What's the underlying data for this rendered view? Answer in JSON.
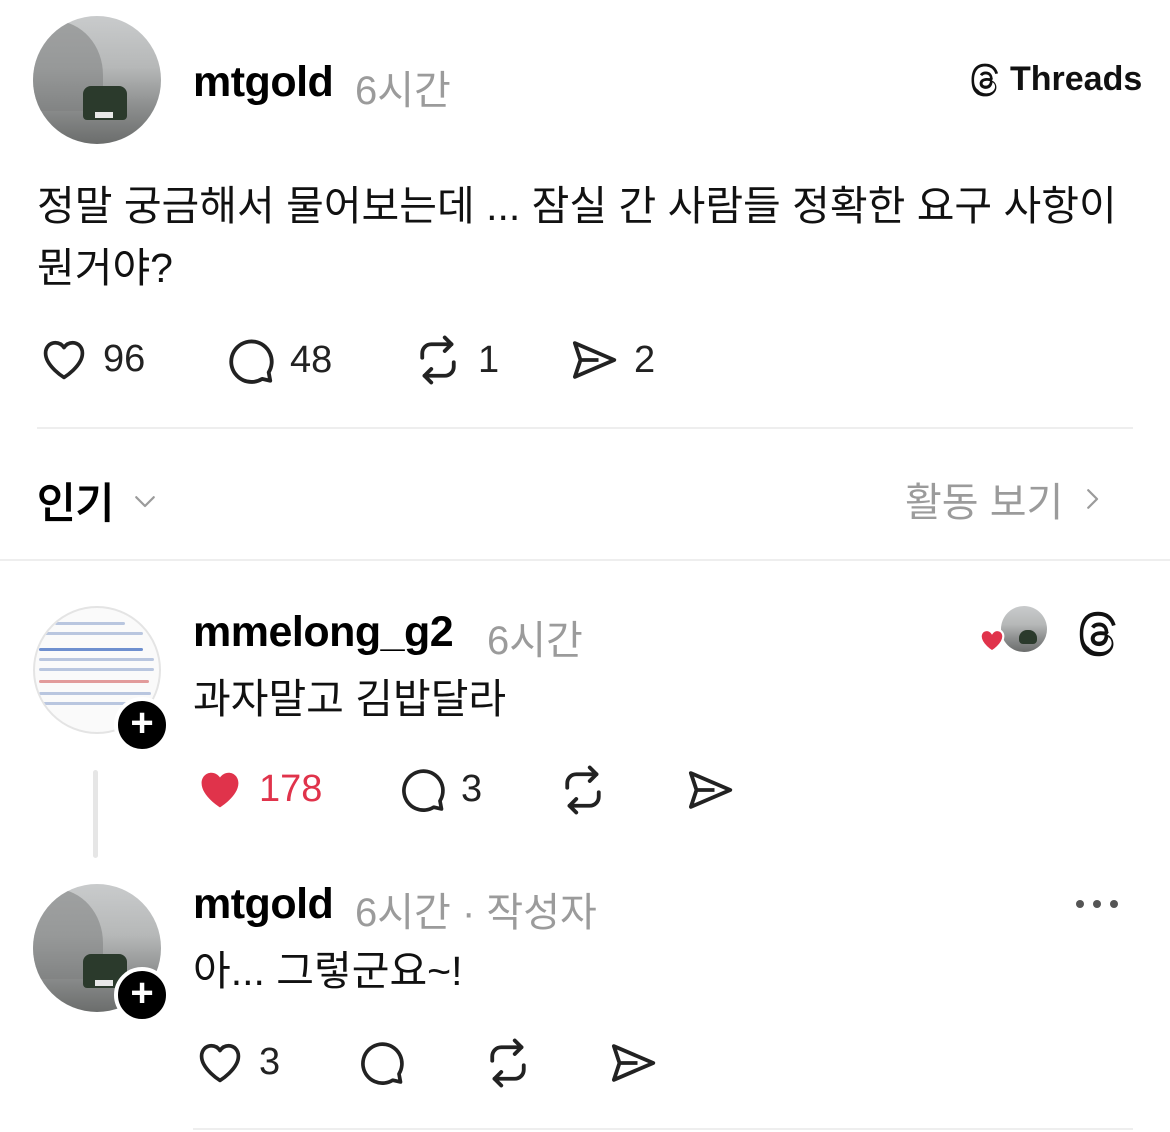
{
  "post": {
    "username": "mtgold",
    "time": "6시간",
    "text": "정말 궁금해서 물어보는데 ... 잠실 간 사람들 정확한 요구 사항이 뭔거야?",
    "actions": {
      "likes": "96",
      "replies": "48",
      "reposts": "1",
      "shares": "2"
    }
  },
  "header": {
    "threads_label": "Threads"
  },
  "sort": {
    "label": "인기",
    "activity_label": "활동 보기"
  },
  "replies": [
    {
      "username": "mmelong_g2",
      "time": "6시간",
      "text": "과자말고 김밥달라",
      "likes": "178",
      "replies": "3",
      "liked": true
    },
    {
      "username": "mtgold",
      "time": "6시간",
      "author_tag": "· 작성자",
      "text": "아... 그렇군요~!",
      "likes": "3"
    }
  ],
  "colors": {
    "accent_like": "#e0334b",
    "muted": "#9b9b9b"
  }
}
